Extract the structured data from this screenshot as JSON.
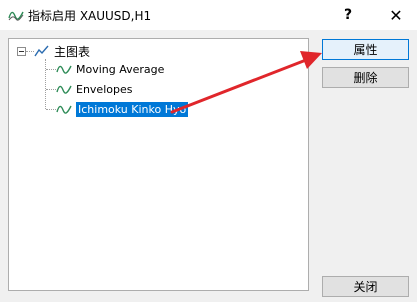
{
  "window": {
    "title": "指标启用 XAUUSD,H1",
    "help_glyph": "?",
    "close_glyph": "✕",
    "title_icon": "indicator-wave-icon"
  },
  "tree": {
    "root": {
      "label": "主图表",
      "icon": "chart-line-icon",
      "expanded": true
    },
    "children": [
      {
        "label": "Moving Average",
        "icon": "indicator-wave-icon",
        "selected": false
      },
      {
        "label": "Envelopes",
        "icon": "indicator-wave-icon",
        "selected": false
      },
      {
        "label": "Ichimoku Kinko Hyo",
        "icon": "indicator-wave-icon",
        "selected": true
      }
    ]
  },
  "buttons": {
    "properties": "属性",
    "delete": "删除",
    "close": "关闭"
  },
  "annotation": {
    "arrow_color": "#e0262b"
  },
  "colors": {
    "selection": "#0078d7",
    "icon_green": "#2e8b57"
  }
}
